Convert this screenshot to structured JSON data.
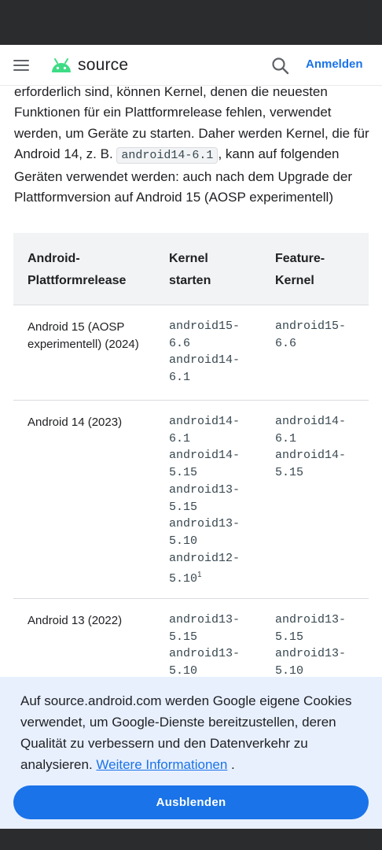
{
  "header": {
    "logo_text": "source",
    "signin_label": "Anmelden"
  },
  "content": {
    "para_before": "erforderlich sind, können Kernel, denen die neuesten Funktionen für ein Plattformrelease fehlen, verwendet werden, um Geräte zu starten. Daher werden Kernel, die für Android 14, z. B. ",
    "para_code": "android14-6.1",
    "para_after": ", kann auf folgenden Geräten verwendet werden: auch nach dem Upgrade der Plattformversion auf Android 15 (AOSP experimentell)"
  },
  "table": {
    "headers": {
      "col1_line1": "Android-",
      "col1_line2": "Plattformrelease",
      "col2_line1": "Kernel",
      "col2_line2": "starten",
      "col3_line1": "Feature-",
      "col3_line2": "Kernel"
    },
    "rows": [
      {
        "platform": "Android 15 (AOSP experimentell) (2024)",
        "launch": [
          "android15-",
          "6.6",
          "android14-",
          "6.1"
        ],
        "feature": [
          "android15-",
          "6.6"
        ]
      },
      {
        "platform": "Android 14 (2023)",
        "launch": [
          "android14-",
          "6.1",
          "android14-",
          "5.15",
          "android13-",
          "5.15",
          "android13-",
          "5.10",
          "android12-",
          "5.10"
        ],
        "launch_footnote": "1",
        "feature": [
          "android14-",
          "6.1",
          "android14-",
          "5.15"
        ]
      },
      {
        "platform": "Android 13 (2022)",
        "launch": [
          "android13-",
          "5.15",
          "android13-",
          "5.10"
        ],
        "feature": [
          "android13-",
          "5.15",
          "android13-",
          "5.10"
        ]
      }
    ]
  },
  "cookie": {
    "text": "Auf source.android.com werden Google eigene Cookies verwendet, um Google-Dienste bereitzustellen, deren Qualität zu verbessern und den Datenverkehr zu analysieren. ",
    "link": "Weitere Informationen",
    "after": " .",
    "button": "Ausblenden"
  },
  "colors": {
    "accent": "#1a73e8",
    "android_green": "#3ddc84",
    "cookie_bg": "#e8f0fe",
    "table_header_bg": "#f1f3f4"
  },
  "icons": [
    "menu-icon",
    "android-logo-icon",
    "search-icon"
  ]
}
